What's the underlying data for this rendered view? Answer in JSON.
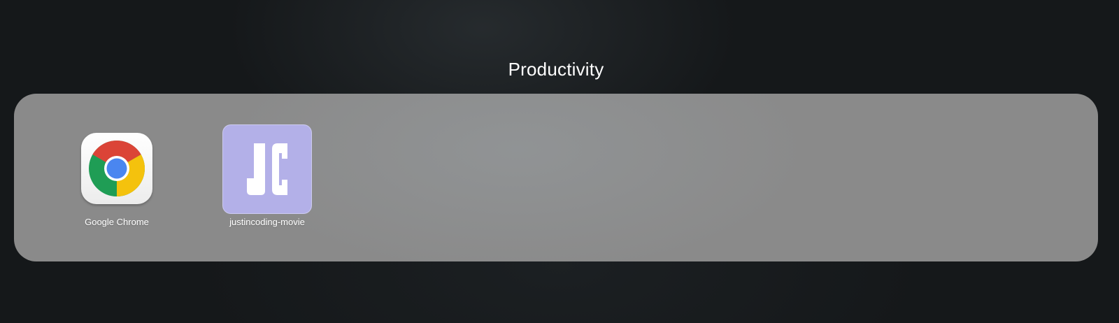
{
  "folder": {
    "title": "Productivity",
    "apps": [
      {
        "label": "Google Chrome",
        "icon": "chrome-icon"
      },
      {
        "label": "justincoding-movie",
        "icon": "jc-logo-icon",
        "icon_text": "JC",
        "icon_color": "#b3b0e8"
      }
    ]
  },
  "colors": {
    "background": "#15181a",
    "folder_panel": "#8a8a8a",
    "label_text": "#ffffff"
  }
}
